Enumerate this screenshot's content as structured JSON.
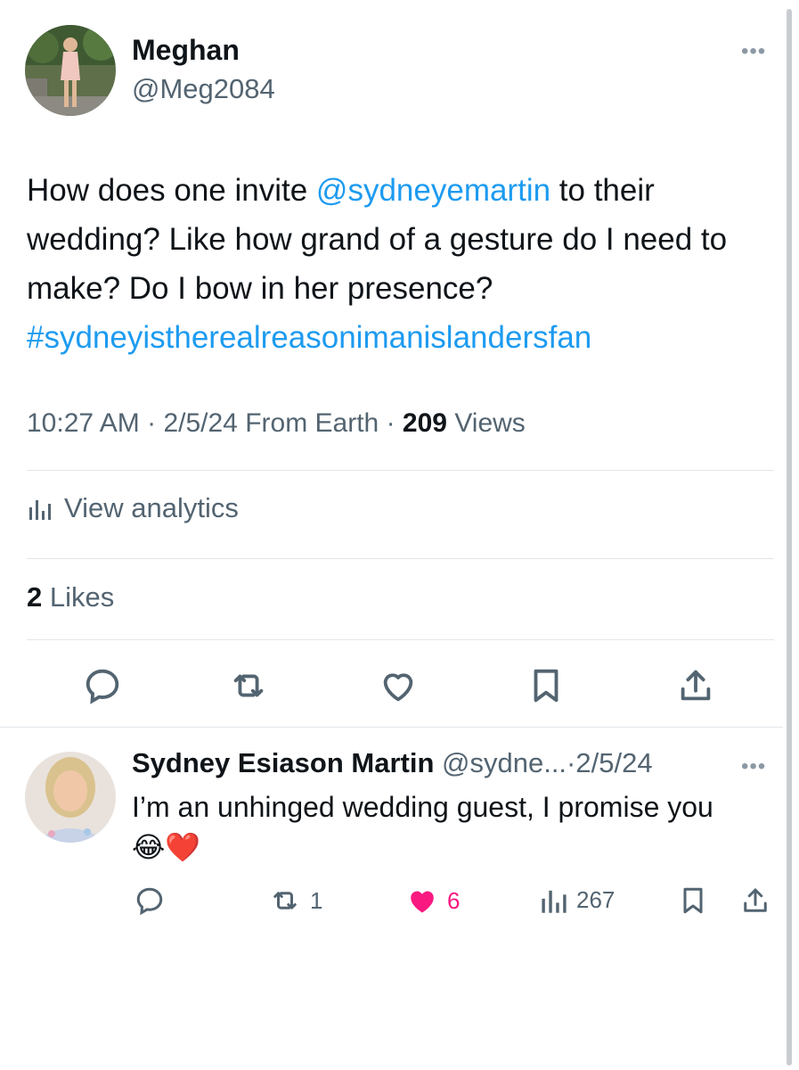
{
  "tweet": {
    "author_name": "Meghan",
    "author_handle": "@Meg2084",
    "text_part1": "How does one invite ",
    "mention": "@sydneyemartin",
    "text_part2": " to their wedding? Like how grand of a gesture do I need to make? Do I bow in her presence?",
    "hashtag": "#sydneyistherealreasonimanislandersfan",
    "time": "10:27 AM",
    "date": "2/5/24",
    "source": "From Earth",
    "views_count": "209",
    "views_label": "Views",
    "analytics_label": "View analytics",
    "likes_count": "2",
    "likes_label": "Likes"
  },
  "reply": {
    "author_name": "Sydney Esiason Martin",
    "author_handle": "@sydne...",
    "date": "2/5/24",
    "text": "I’m an unhinged wedding guest, I promise you",
    "emoji": "😂❤️",
    "retweets": "1",
    "likes": "6",
    "views": "267"
  },
  "icons": [
    "more-icon",
    "analytics-icon",
    "reply-icon",
    "retweet-icon",
    "like-icon",
    "bookmark-icon",
    "share-icon"
  ],
  "colors": {
    "link": "#1d9bf0",
    "like_active": "#f91880",
    "secondary_text": "#536471"
  }
}
